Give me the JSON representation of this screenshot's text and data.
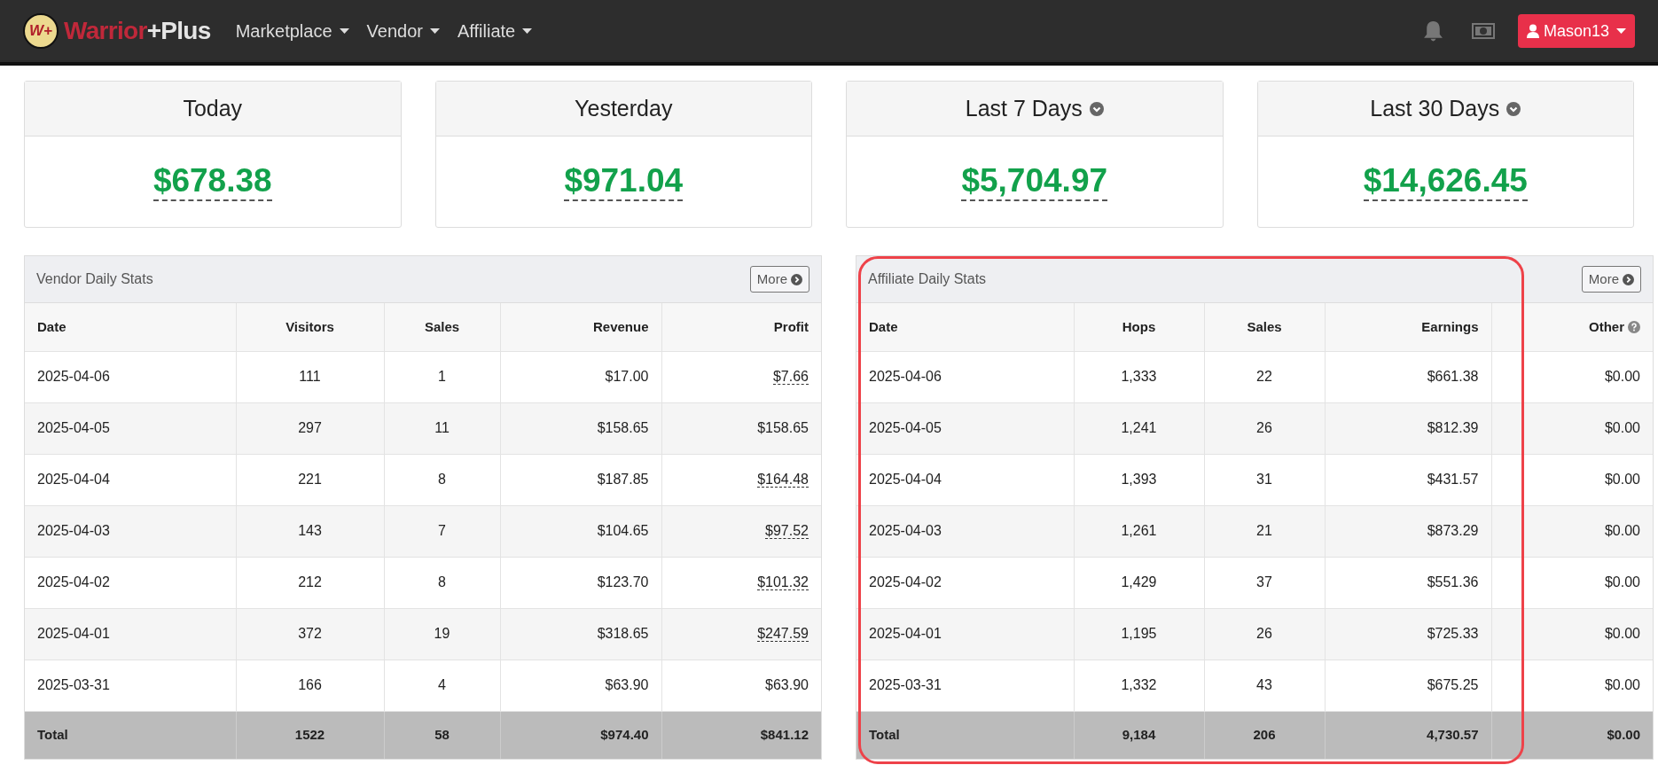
{
  "navbar": {
    "brand": {
      "badge": "W+",
      "word_1": "Warrior",
      "word_2": "+Plus"
    },
    "menus": [
      {
        "label": "Marketplace"
      },
      {
        "label": "Vendor"
      },
      {
        "label": "Affiliate"
      }
    ],
    "user": "Mason13"
  },
  "summary": [
    {
      "label": "Today",
      "amount": "$678.38",
      "dropdown": false
    },
    {
      "label": "Yesterday",
      "amount": "$971.04",
      "dropdown": false
    },
    {
      "label": "Last 7 Days",
      "amount": "$5,704.97",
      "dropdown": true
    },
    {
      "label": "Last 30 Days",
      "amount": "$14,626.45",
      "dropdown": true
    }
  ],
  "vendor_stats": {
    "title": "Vendor Daily Stats",
    "more": "More",
    "columns": [
      {
        "label": "Date",
        "help": false
      },
      {
        "label": "Visitors",
        "help": false
      },
      {
        "label": "Sales",
        "help": false
      },
      {
        "label": "Revenue",
        "help": false
      },
      {
        "label": "Profit",
        "help": false
      }
    ],
    "rows": [
      {
        "cells": [
          "2025-04-06",
          "111",
          "1",
          "$17.00",
          "$7.66"
        ],
        "last_tooltip": true
      },
      {
        "cells": [
          "2025-04-05",
          "297",
          "11",
          "$158.65",
          "$158.65"
        ],
        "last_tooltip": false
      },
      {
        "cells": [
          "2025-04-04",
          "221",
          "8",
          "$187.85",
          "$164.48"
        ],
        "last_tooltip": true
      },
      {
        "cells": [
          "2025-04-03",
          "143",
          "7",
          "$104.65",
          "$97.52"
        ],
        "last_tooltip": true
      },
      {
        "cells": [
          "2025-04-02",
          "212",
          "8",
          "$123.70",
          "$101.32"
        ],
        "last_tooltip": true
      },
      {
        "cells": [
          "2025-04-01",
          "372",
          "19",
          "$318.65",
          "$247.59"
        ],
        "last_tooltip": true
      },
      {
        "cells": [
          "2025-03-31",
          "166",
          "4",
          "$63.90",
          "$63.90"
        ],
        "last_tooltip": false
      }
    ],
    "total": [
      "Total",
      "1522",
      "58",
      "$974.40",
      "$841.12"
    ]
  },
  "affiliate_stats": {
    "title": "Affiliate Daily Stats",
    "more": "More",
    "highlighted": true,
    "columns": [
      {
        "label": "Date",
        "help": false
      },
      {
        "label": "Hops",
        "help": false
      },
      {
        "label": "Sales",
        "help": false
      },
      {
        "label": "Earnings",
        "help": false
      },
      {
        "label": "Other",
        "help": true
      }
    ],
    "rows": [
      {
        "cells": [
          "2025-04-06",
          "1,333",
          "22",
          "$661.38",
          "$0.00"
        ]
      },
      {
        "cells": [
          "2025-04-05",
          "1,241",
          "26",
          "$812.39",
          "$0.00"
        ]
      },
      {
        "cells": [
          "2025-04-04",
          "1,393",
          "31",
          "$431.57",
          "$0.00"
        ]
      },
      {
        "cells": [
          "2025-04-03",
          "1,261",
          "21",
          "$873.29",
          "$0.00"
        ]
      },
      {
        "cells": [
          "2025-04-02",
          "1,429",
          "37",
          "$551.36",
          "$0.00"
        ]
      },
      {
        "cells": [
          "2025-04-01",
          "1,195",
          "26",
          "$725.33",
          "$0.00"
        ]
      },
      {
        "cells": [
          "2025-03-31",
          "1,332",
          "43",
          "$675.25",
          "$0.00"
        ]
      }
    ],
    "total": [
      "Total",
      "9,184",
      "206",
      "4,730.57",
      "$0.00"
    ]
  }
}
